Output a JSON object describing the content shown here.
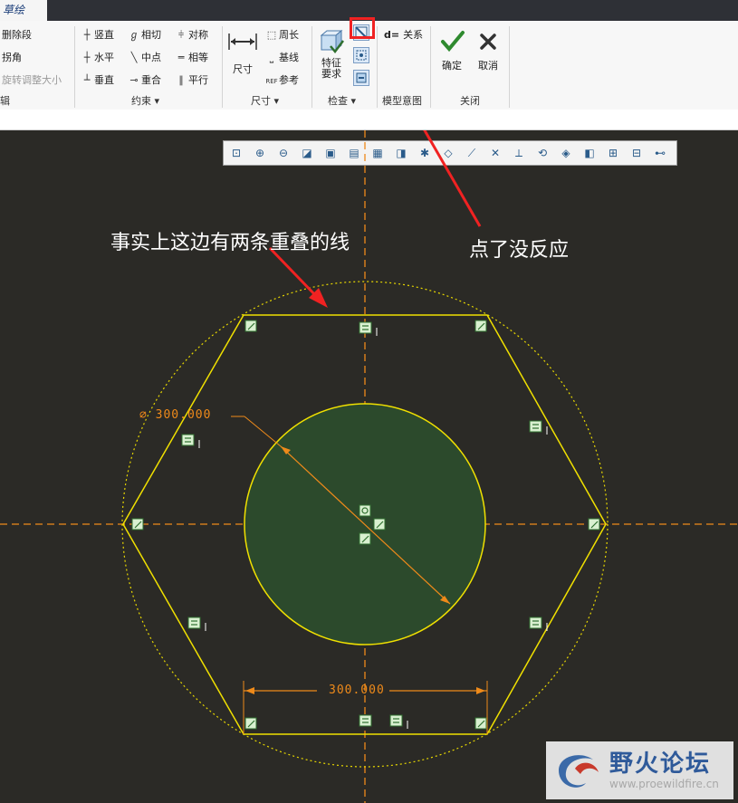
{
  "tab": {
    "label": "草绘"
  },
  "ribbon": {
    "edit": {
      "items": [
        {
          "label": "删除段",
          "enabled": true
        },
        {
          "label": "拐角",
          "enabled": true
        },
        {
          "label": "旋转调整大小",
          "enabled": false
        }
      ],
      "group_label": "辑"
    },
    "constraints": {
      "col1": [
        {
          "label": "竖直",
          "icon": "vertical-constraint-icon"
        },
        {
          "label": "水平",
          "icon": "horizontal-constraint-icon"
        },
        {
          "label": "垂直",
          "icon": "perpendicular-constraint-icon"
        }
      ],
      "col2": [
        {
          "label": "相切",
          "icon": "tangent-constraint-icon"
        },
        {
          "label": "中点",
          "icon": "midpoint-constraint-icon"
        },
        {
          "label": "重合",
          "icon": "coincident-constraint-icon"
        }
      ],
      "col3": [
        {
          "label": "对称",
          "icon": "symmetric-constraint-icon"
        },
        {
          "label": "相等",
          "icon": "equal-constraint-icon"
        },
        {
          "label": "平行",
          "icon": "parallel-constraint-icon"
        }
      ],
      "group_label": "约束 ▾"
    },
    "dimension": {
      "main_label": "尺寸",
      "items": [
        {
          "label": "周长",
          "icon": "perimeter-icon"
        },
        {
          "label": "基线",
          "icon": "baseline-icon"
        },
        {
          "label": "参考",
          "icon": "reference-icon"
        }
      ],
      "group_label": "尺寸 ▾"
    },
    "inspect": {
      "main_label_1": "特征",
      "main_label_2": "要求",
      "group_label": "检查 ▾"
    },
    "relations": {
      "label": "关系",
      "prefix": "d="
    },
    "model_view": {
      "group_label": "模型意图"
    },
    "close": {
      "ok_label": "确定",
      "cancel_label": "取消",
      "group_label": "关闭"
    }
  },
  "annotations": {
    "left_text": "事实上这边有两条重叠的线",
    "right_text": "点了没反应"
  },
  "dimensions": {
    "diameter_text": "⌀ 300.000",
    "width_text": "300.000"
  },
  "watermark": {
    "title": "野火论坛",
    "url": "www.proewildfire.cn"
  },
  "colors": {
    "background": "#2b2a26",
    "sketch_line": "#f0e000",
    "dimension": "#ee8a1a",
    "circle_fill": "#2c4a2c",
    "highlight_box": "#f02222"
  }
}
